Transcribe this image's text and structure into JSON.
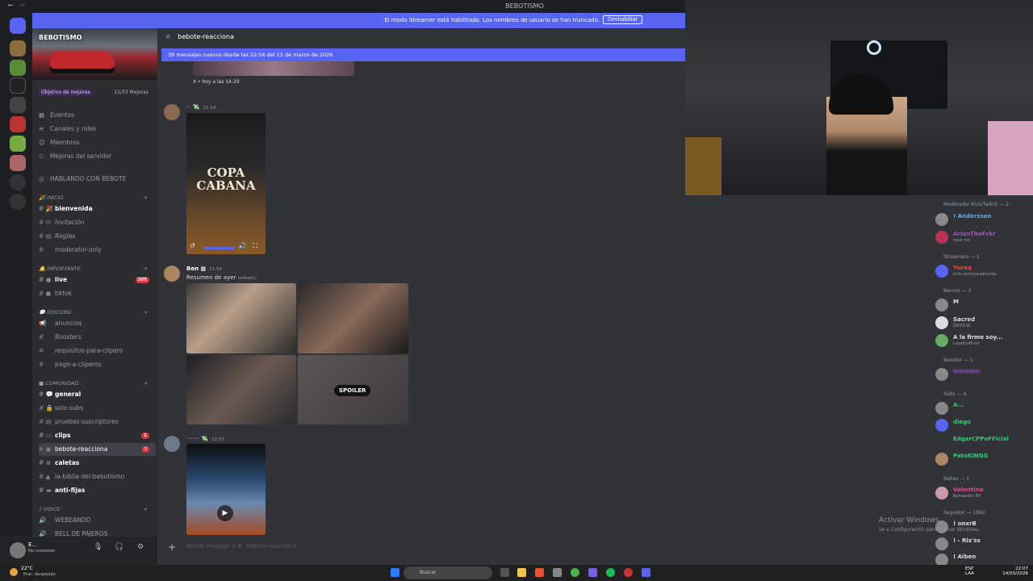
{
  "window": {
    "title": "BEBOTISMO"
  },
  "banner": {
    "message": "El modo Streamer está habilitado. Los nombres de usuario se han truncado.",
    "button": "Deshabilitar"
  },
  "server": {
    "name": "BEBOTISMO",
    "boost_goal": "Objetivo de mejoras",
    "boost_count": "11/33 Mejoras",
    "menu": [
      "Eventos",
      "Canales y roles",
      "Miembros",
      "Mejoras del servidor"
    ],
    "talking": "HABLANDO CON BEBOTE"
  },
  "categories": {
    "inicio": "INICIO",
    "importante": "IMPORTANTE",
    "discord": "DISCORD",
    "comunidad": "COMUNIDAD",
    "voice": "VOICE"
  },
  "channels": {
    "bienvenida": "bienvenida",
    "invitacion": "Invitación",
    "reglas": "Reglas",
    "moderator": "moderator-only",
    "live": "live",
    "live_badge": "205",
    "tiktok": "tiktok",
    "anuncios": "anuncios",
    "boosters": "Boosters",
    "requisitos": "requisitos-para-clipero",
    "pago": "pago-a-cliperos",
    "general": "general",
    "solo_subs": "solo-subs",
    "pruebas": "pruebas-suscriptores",
    "clips": "clips",
    "clips_badge": "1",
    "bebote": "bebote-reacciona",
    "bebote_badge": "3",
    "caletas": "caletas",
    "biblia": "la-biblia-del-bebotismo",
    "antifijas": "anti-fijas",
    "webeando": "WEBEANDO",
    "pajeros": "BELL DE PAJEROS"
  },
  "user": {
    "name": "E...",
    "status": "No molestar"
  },
  "chat": {
    "channel_name": "bebote-reacciona",
    "new_messages": "39 mensajes nuevos desde las 22:56 del 13 de marzo de 2026",
    "embed_source": "X • hoy a las 14:29",
    "msg1_time": "21:54",
    "video_title": "COPA CABANA",
    "msg2_author": "Ben",
    "msg2_time": "21:54",
    "msg2_text": "Resumen de ayer",
    "msg2_edited": "(editado)",
    "spoiler": "SPOILER",
    "msg3_time": "21:55",
    "input_placeholder": "Enviar mensaje a #",
    "input_channel": "bebote-reacciona"
  },
  "members": {
    "mod_cat": "Moderador Kick/Twitch — 2",
    "mod1": "! Andersson",
    "mod2": "ArianTheFckr",
    "mod2_sub": "rave me",
    "streamers_cat": "Streamers — 1",
    "str1": "Yuraq",
    "str1_sub": "kick.com/yuraqhanka",
    "narcos_cat": "Narcos — 3",
    "n1": "M",
    "n2": "Sacred",
    "n2_sub": "DEVOUR",
    "n3": "A la firme soy...",
    "n3_sub": "Loyalty4Ever",
    "booster_cat": "Booster — 1",
    "subs_cat": "Subs — 4",
    "s1": "A...",
    "s2": "diego",
    "s3": "EdgarCPPoFFicial",
    "s4": "PatoKINGG",
    "bebes_cat": "Bebes — 1",
    "b1": "Valentina",
    "b1_sub": "Bamacdos RP",
    "seguidor_cat": "Seguidor — 1882",
    "f1": "! onxrB",
    "f2": "! - Rix'ss",
    "f3": "! Aiben"
  },
  "watermark": {
    "line1": "Activar Windows",
    "line2": "Ve a Configuración para activar Windows."
  },
  "taskbar": {
    "temp": "22°C",
    "weather": "Prac. despejado",
    "search": "Buscar",
    "lang1": "ESP",
    "lang2": "LAA",
    "time": "22:07",
    "date": "14/03/2026"
  }
}
